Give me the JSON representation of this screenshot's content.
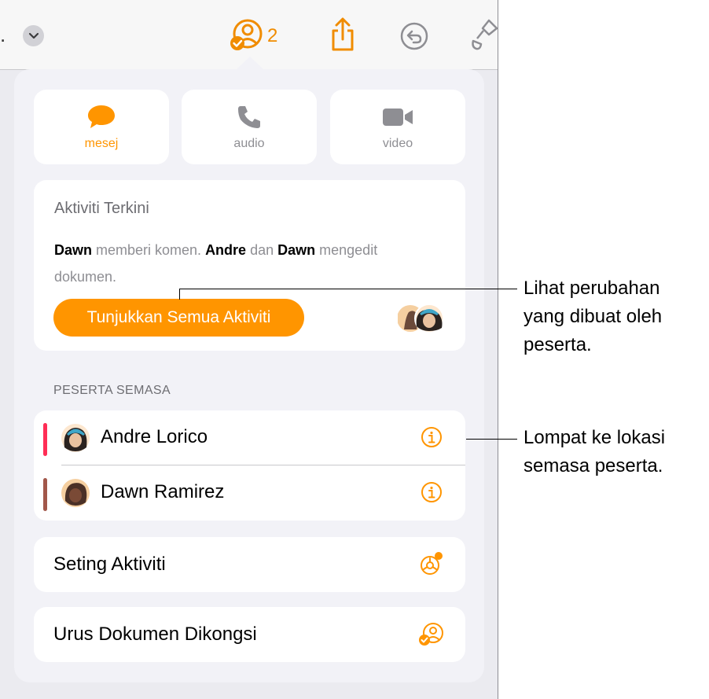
{
  "toolbar": {
    "overflow_dot": ".",
    "collab_count": "2"
  },
  "comm": {
    "message_label": "mesej",
    "audio_label": "audio",
    "video_label": "video"
  },
  "activity": {
    "title": "Aktiviti Terkini",
    "name1": "Dawn",
    "text1": " memberi komen. ",
    "name2": "Andre",
    "text2": " dan ",
    "name3": "Dawn",
    "text3": " mengedit dokumen.",
    "button_label": "Tunjukkan Semua Aktiviti"
  },
  "participants": {
    "header": "PESERTA SEMASA",
    "items": [
      {
        "name": "Andre Lorico",
        "bar_color": "#ff2d55"
      },
      {
        "name": "Dawn Ramirez",
        "bar_color": "#a2574a"
      }
    ]
  },
  "settings": {
    "activity_settings": "Seting Aktiviti",
    "manage_shared": "Urus Dokumen Dikongsi"
  },
  "callouts": {
    "show_changes": [
      "Lihat perubahan",
      "yang dibuat oleh",
      "peserta."
    ],
    "jump_location": [
      "Lompat ke lokasi",
      "semasa peserta."
    ]
  },
  "colors": {
    "accent": "#ff9500",
    "toolbar_accent": "#f08c00"
  }
}
